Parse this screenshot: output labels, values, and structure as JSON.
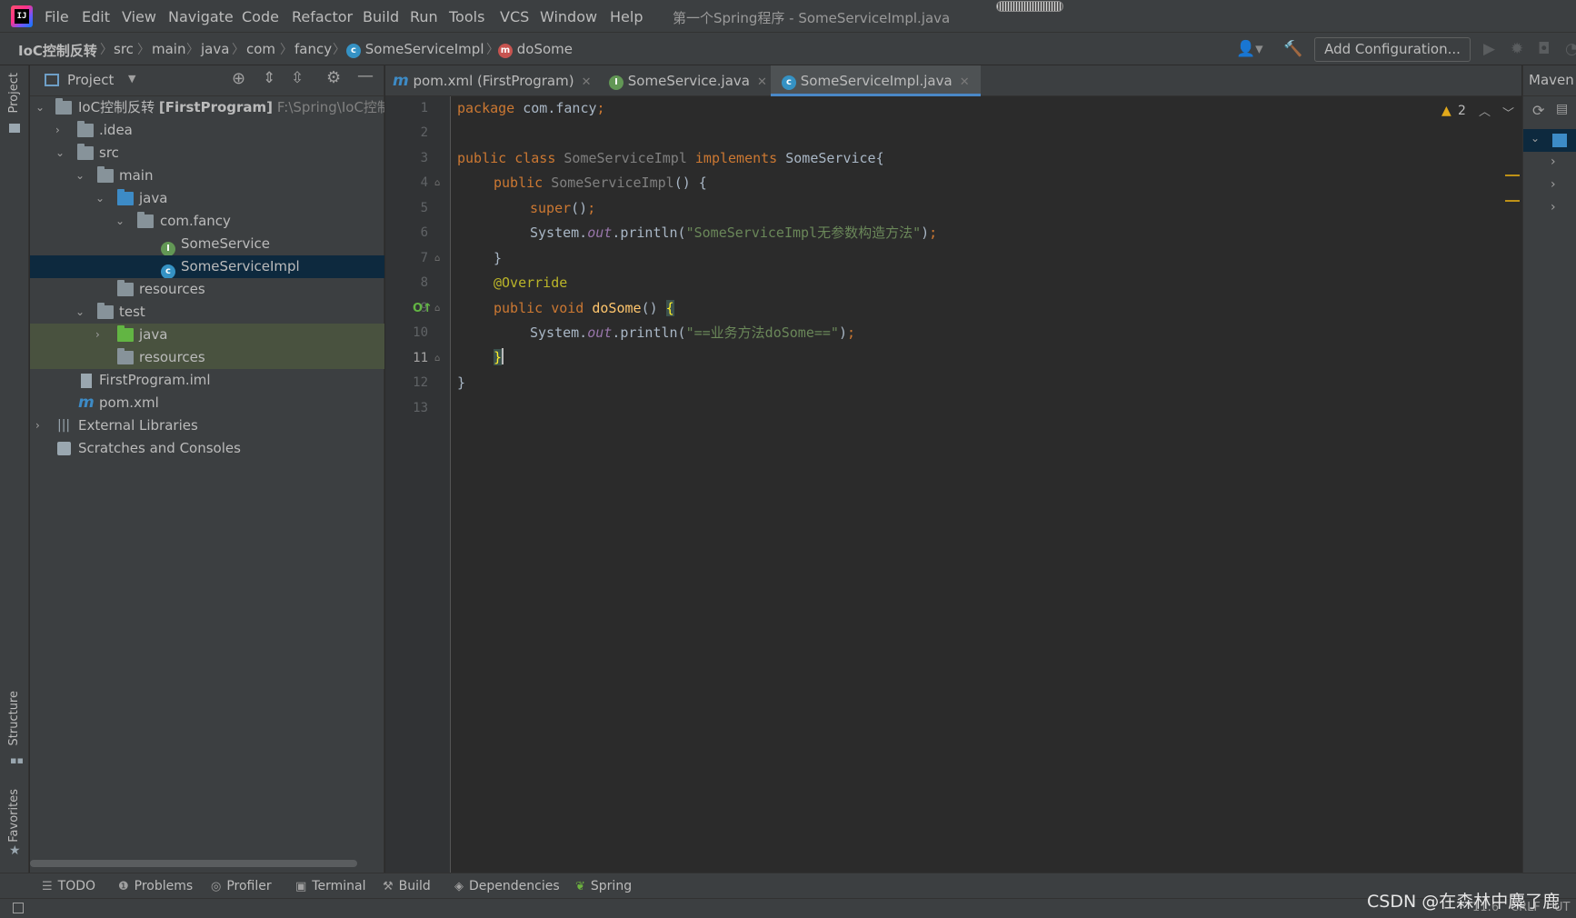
{
  "app": {
    "window_title": "第一个Spring程序 - SomeServiceImpl.java",
    "menu": [
      "File",
      "Edit",
      "View",
      "Navigate",
      "Code",
      "Refactor",
      "Build",
      "Run",
      "Tools",
      "VCS",
      "Window",
      "Help"
    ]
  },
  "breadcrumb": {
    "items": [
      "IoC控制反转",
      "src",
      "main",
      "java",
      "com",
      "fancy",
      "SomeServiceImpl",
      "doSome"
    ]
  },
  "toolbar": {
    "add_configuration": "Add Configuration..."
  },
  "project_panel": {
    "title": "Project",
    "tree": [
      {
        "label": "IoC控制反转",
        "module": "[FirstProgram]",
        "path": "F:\\Spring\\IoC控制反"
      },
      {
        "label": ".idea"
      },
      {
        "label": "src"
      },
      {
        "label": "main"
      },
      {
        "label": "java"
      },
      {
        "label": "com.fancy"
      },
      {
        "label": "SomeService"
      },
      {
        "label": "SomeServiceImpl"
      },
      {
        "label": "resources"
      },
      {
        "label": "test"
      },
      {
        "label": "java"
      },
      {
        "label": "resources"
      },
      {
        "label": "FirstProgram.iml"
      },
      {
        "label": "pom.xml"
      },
      {
        "label": "External Libraries"
      },
      {
        "label": "Scratches and Consoles"
      }
    ]
  },
  "tool_strip": {
    "project": "Project",
    "structure": "Structure",
    "favorites": "Favorites",
    "maven": "Maven"
  },
  "editor": {
    "tabs": [
      {
        "label": "pom.xml (FirstProgram)",
        "icon": "maven-icon"
      },
      {
        "label": "SomeService.java",
        "icon": "interface-icon"
      },
      {
        "label": "SomeServiceImpl.java",
        "icon": "class-icon",
        "active": true
      }
    ],
    "warnings_count": "2",
    "line_numbers": [
      "1",
      "2",
      "3",
      "4",
      "5",
      "6",
      "7",
      "8",
      "9",
      "10",
      "11",
      "12",
      "13"
    ],
    "current_line": "11",
    "code": {
      "l1_kw": "package",
      "l1_rest": " com.fancy",
      "l1_semi": ";",
      "l3_kw": "public class",
      "l3_name": "SomeServiceImpl",
      "l3_impl": "implements",
      "l3_iface": "SomeService{",
      "l4_kw": "public",
      "l4_name": "SomeServiceImpl",
      "l4_rest": "() {",
      "l5_kw": "super",
      "l5_rest": "()",
      "l5_semi": ";",
      "l6_a": "System.",
      "l6_out": "out",
      "l6_b": ".println(",
      "l6_str": "\"SomeServiceImpl无参数构造方法\"",
      "l6_c": ")",
      "l6_semi": ";",
      "l7": "}",
      "l8": "@Override",
      "l9_kw": "public void",
      "l9_fn": "doSome",
      "l9_rest": "() ",
      "l9_brace": "{",
      "l10_a": "System.",
      "l10_out": "out",
      "l10_b": ".println(",
      "l10_str": "\"==业务方法doSome==\"",
      "l10_c": ")",
      "l10_semi": ";",
      "l11": "}",
      "l12": "}"
    }
  },
  "bottom_tools": [
    "TODO",
    "Problems",
    "Profiler",
    "Terminal",
    "Build",
    "Dependencies",
    "Spring"
  ],
  "status": {
    "position": "11:6",
    "line_sep": "CRLF",
    "encoding": "UT"
  },
  "watermark": "CSDN @在森林中麋了鹿",
  "colors": {
    "accent": "#4a88c7",
    "keyword": "#cc7832",
    "string": "#6a8759",
    "annotation": "#bbb529",
    "method": "#ffc66d"
  }
}
